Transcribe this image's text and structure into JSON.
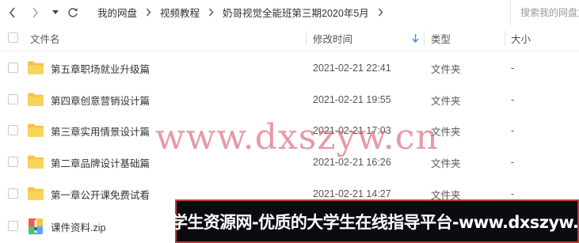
{
  "nav": {
    "breadcrumbs": [
      "我的网盘",
      "视频教程",
      "奶哥视觉全能班第三期2020年5月"
    ],
    "search_placeholder": "搜索我的网盘文件"
  },
  "columns": {
    "name": "文件名",
    "modified": "修改时间",
    "type": "类型",
    "size": "大小"
  },
  "rows": [
    {
      "name": "第五章职场就业升级篇",
      "modified": "2021-02-21 22:41",
      "type": "文件夹",
      "size": "-",
      "icon": "folder-icon"
    },
    {
      "name": "第四章创意营销设计篇",
      "modified": "2021-02-21 19:55",
      "type": "文件夹",
      "size": "-",
      "icon": "folder-icon"
    },
    {
      "name": "第三章实用情景设计篇",
      "modified": "2021-02-21 17:03",
      "type": "文件夹",
      "size": "-",
      "icon": "folder-icon"
    },
    {
      "name": "第二章品牌设计基础篇",
      "modified": "2021-02-21 16:26",
      "type": "文件夹",
      "size": "-",
      "icon": "folder-icon"
    },
    {
      "name": "第一章公开课免费试看",
      "modified": "2021-02-21 14:27",
      "type": "文件夹",
      "size": "-",
      "icon": "folder-icon"
    },
    {
      "name": "课件资料.zip",
      "icon": "zip-archive-icon"
    }
  ],
  "watermark": "www.dxszyw.cn",
  "banner": "大学生资源网-优质的大学生在线指导平台-www.dxszyw.cn",
  "colors": {
    "folder": "#f6c343",
    "banner_bg": "#0b0b10",
    "banner_border": "#c23a34",
    "watermark": "#d65c70",
    "sort_arrow": "#3b8cf5"
  }
}
